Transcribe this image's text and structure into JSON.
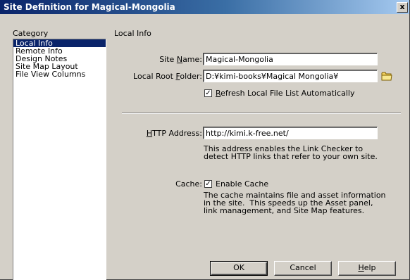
{
  "window": {
    "title": "Site Definition for Magical-Mongolia",
    "close_label": "x"
  },
  "category": {
    "header": "Category",
    "items": [
      {
        "label": "Local Info",
        "selected": true
      },
      {
        "label": "Remote Info",
        "selected": false
      },
      {
        "label": "Design Notes",
        "selected": false
      },
      {
        "label": "Site Map Layout",
        "selected": false
      },
      {
        "label": "File View Columns",
        "selected": false
      }
    ]
  },
  "panel": {
    "header": "Local Info",
    "site_name": {
      "label_pre": "Site ",
      "label_key": "N",
      "label_post": "ame:",
      "value": "Magical-Mongolia"
    },
    "local_root": {
      "label_pre": "Local Root ",
      "label_key": "F",
      "label_post": "older:",
      "value": "D:¥kimi-books¥Magical Mongolia¥",
      "folder_icon": "folder-icon"
    },
    "refresh": {
      "checked": true,
      "label_key": "R",
      "label_post": "efresh Local File List Automatically"
    },
    "http": {
      "label_key": "H",
      "label_post": "TTP Address:",
      "value": "http://kimi.k-free.net/",
      "description": "This address enables the Link Checker to\ndetect HTTP links that refer to your own site."
    },
    "cache": {
      "label": "Cache:",
      "checked": true,
      "checkbox_label": "Enable Cache",
      "description": "The cache maintains file and asset information\nin the site.  This speeds up the Asset panel,\nlink management, and Site Map features."
    }
  },
  "buttons": {
    "ok": "OK",
    "cancel": "Cancel",
    "help_key": "H",
    "help_post": "elp"
  },
  "colors": {
    "face": "#d4d0c8",
    "selection": "#0a246a",
    "title_start": "#0a246a",
    "title_end": "#a6caf0"
  }
}
